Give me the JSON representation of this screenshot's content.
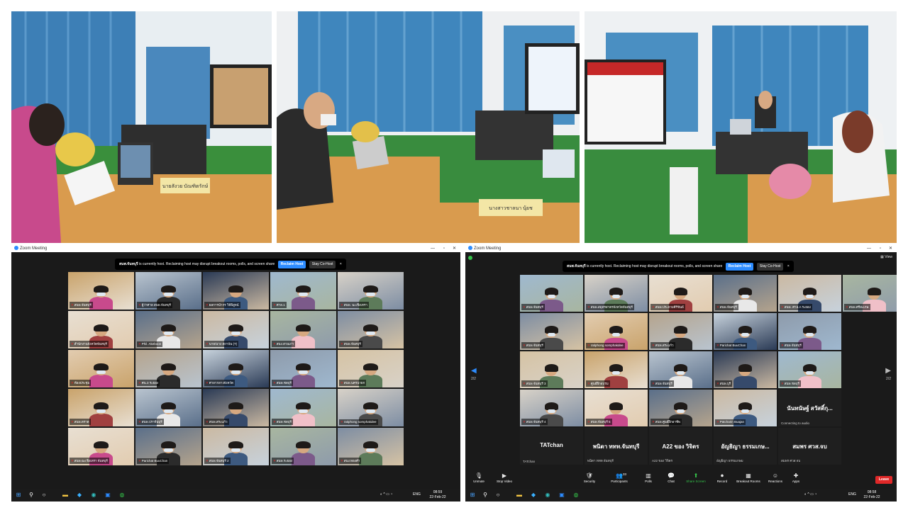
{
  "photos": [
    {
      "name": "photo-meeting-room-1",
      "placard": "นายสังวย บัณฑิตรักษ์"
    },
    {
      "name": "photo-meeting-room-2",
      "placard": "นางสาวชาลนา นุ้ยช"
    },
    {
      "name": "photo-meeting-room-3",
      "placard": ""
    }
  ],
  "left_window": {
    "title": "Zoom Meeting",
    "notif_host": "สนพ.จันทบุรี",
    "notif_text": " is currently host. Reclaiming host may disrupt breakout rooms, polls, and screen share",
    "reclaim": "Reclaim Host",
    "stay": "Stay Co-Host",
    "close": "×",
    "tiles": [
      "สนพ.จันทบุรี",
      "ผู้ว่าศาล สนพ.จันทบุรี",
      "ผลการนำกร วิธีพิสูจน์",
      "ศาล.1",
      "สนพ. ฉะเชิงเทรา",
      "สำนักงานจังหวัดจันทบุรี",
      "Phil. Akeboon",
      "นาย/นาง สถาบัน (T)",
      "สนง.สวนเก่า",
      "สนพ.จันทบุรี",
      "ห้องประชุม",
      "ศน.3 ระยอง",
      "ศาลากลางจังหวัด",
      "สนพ.ชลบุรี",
      "สนพ.นครนายก",
      "สนพ.ตราด",
      "สนพ.ปราจีนบุรี",
      "สนพ.สระแก้ว",
      "สนพ.ชลบุรี",
      "ratiphong somphakdee",
      "สนพ.ฉะเชิงเทรา จันทบุรี",
      "Parichat BuuChan",
      "สนพ.จันทบุรี 2",
      "สนพ.ระยอง",
      "สนง.ทองคำ"
    ]
  },
  "right_window": {
    "title": "Zoom Meeting",
    "view": "View",
    "notif_host": "สนพ.จันทบุรี",
    "notif_text": " is currently host. Reclaiming host may disrupt breakout rooms, polls, and screen share",
    "reclaim": "Reclaim Host",
    "stay": "Stay Co-Host",
    "close": "×",
    "page_left": "2/2",
    "page_right": "2/2",
    "tiles": [
      "สนพ.จันทบุรี",
      "สนพ.สมุทรสาครจังหวัดจันทบุรี",
      "สนพ.ประจวบคีรีขันธ์",
      "สนพ.จันทบุรี",
      "สนพ. ศาล.A ระยอง",
      "สนพ.ศรีสะเกษ",
      "สนพ.จันทบุรี",
      "ratiphong somphakdee",
      "สนพ.สระแก้ว",
      "Parichat BuuChan",
      "สนพ.จันทบุรี",
      "สนพ.จันทบุรี 3",
      "ศูนย์ฝึกอบรม",
      "สนพ.จันทบุรี",
      "สนพ.บุรี",
      "สนพ.ชลบุรี",
      "สนพ.จันทบุรี 4",
      "สนพ.จันทบุรี 5",
      "สนพ.ศูนย์ฝึกอาชีพ",
      "Patcharin Buajan"
    ],
    "text_tiles": [
      {
        "big": "นันทนัษฐ์ สวัสดิ์กุ...",
        "sub": "Connecting to audio"
      },
      {
        "big": "TATchan",
        "sub": "TATchan"
      },
      {
        "big": "พนิดา ททท.จันทบุรี",
        "sub": "พนิดา ททท.จันทบุรี"
      },
      {
        "big": "A22 ของ วิจิตร",
        "sub": "A22 ของ วิจิตร"
      },
      {
        "big": "อัญธิญา ธรรมเกษ...",
        "sub": "อัญธิญา ธรรมเกษม"
      },
      {
        "big": "สมพร ศวส.จบ",
        "sub": "สมพร ศวส.จบ"
      }
    ],
    "toolbar": [
      {
        "label": "Unmute",
        "icon": "🎙"
      },
      {
        "label": "Stop Video",
        "icon": "▶"
      },
      {
        "label": "Security",
        "icon": "🛡"
      },
      {
        "label": "Participants",
        "icon": "👥"
      },
      {
        "label": "Polls",
        "icon": "▥"
      },
      {
        "label": "Chat",
        "icon": "💬"
      },
      {
        "label": "Share Screen",
        "icon": "⬆"
      },
      {
        "label": "Record",
        "icon": "⏺"
      },
      {
        "label": "Breakout Rooms",
        "icon": "▦"
      },
      {
        "label": "Reactions",
        "icon": "☺"
      },
      {
        "label": "Apps",
        "icon": "✚"
      }
    ],
    "participants_count": "33",
    "leave": "Leave"
  },
  "taskbar_left": {
    "lang": "ENG",
    "time": "08:59",
    "date": "22-Feb-22"
  },
  "taskbar_right": {
    "lang": "ENG",
    "time": "08:58",
    "date": "22-Feb-22"
  },
  "colors": {
    "zoom_blue": "#2d8cff",
    "leave_red": "#e02828",
    "active_speaker": "#c8e36b"
  }
}
